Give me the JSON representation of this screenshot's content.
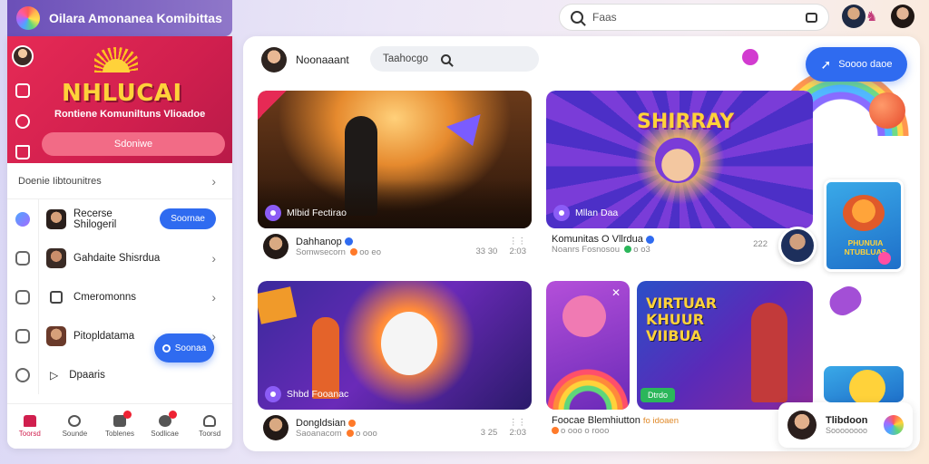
{
  "app": {
    "title": "Oilara Amonanea Komibittas"
  },
  "search": {
    "placeholder": "Faas"
  },
  "sidebar": {
    "hero": {
      "title": "NHLUCAI",
      "subtitle": "Rontiene Komuniltuns Vlioadoe",
      "button_label": "Sdoniwe"
    },
    "section_label": "Doenie Iibtounitres",
    "items": [
      {
        "label": "Recerse Shilogeril",
        "action_label": "Soornae"
      },
      {
        "label": "Gahdaite Shisrdua"
      },
      {
        "label": "Cmeromonns"
      },
      {
        "label": "Pitopldatama"
      },
      {
        "label": "Dpaaris"
      }
    ],
    "float_button_label": "Soonaa",
    "bottom_nav": [
      {
        "label": "Toorsd"
      },
      {
        "label": "Sounde"
      },
      {
        "label": "Toblenes"
      },
      {
        "label": "Sodlicae"
      },
      {
        "label": "Toorsd"
      }
    ]
  },
  "main": {
    "header": {
      "user_label": "Noonaaant",
      "search_label": "Taahocgo",
      "cta_label": "Soooo daoe"
    },
    "cards": [
      {
        "tag": "Mlbid  Fectirao",
        "author": "Dahhanop",
        "sub": "Somwsecorn",
        "stats": "oo eo",
        "count1": "33 30",
        "count2": "2:03"
      },
      {
        "tag": "Mllan  Daa",
        "author": "Komunitas O Vllrdua",
        "sub": "Noanrs Fosnosou",
        "stats": "o o3",
        "count1": "222",
        "count2": "",
        "banner": "SHIRRAY"
      },
      {
        "tag": "Shbd  Fooanac",
        "author": "Dongldsian",
        "sub": "Saoanacom",
        "stats": "o ooo",
        "count1": "3 25",
        "count2": "2:03"
      },
      {
        "tag": "Dtrdo",
        "author": "Foocae Blemhiutton",
        "sub": "",
        "stats": "o ooo  o rooo",
        "count1": "",
        "count2": "",
        "banner": "VIRTUAR KHUUR VIIBUA",
        "banner_author_suffix": "fo idoaen"
      }
    ],
    "side_banner": "PHUNUIA NTUBLUAS",
    "mini_card": {
      "title": "Tlibdoon",
      "subtitle": "Soooooooo"
    }
  },
  "colors": {
    "accent": "#2f6bf0",
    "hero": "#d01f4e",
    "brand_purple": "#6b4fb8"
  }
}
